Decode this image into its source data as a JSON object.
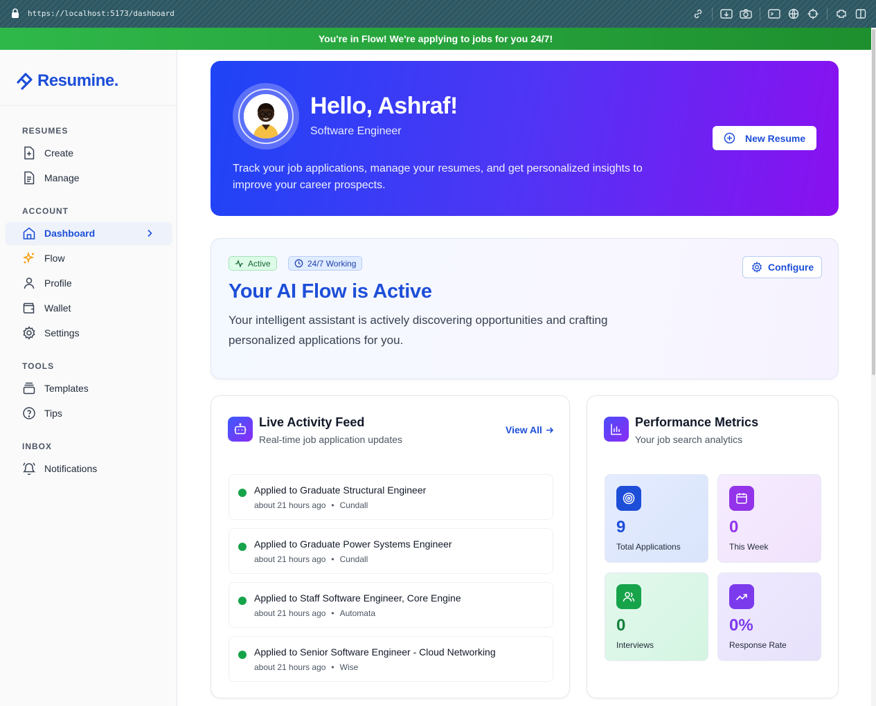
{
  "browser": {
    "url": "https://localhost:5173/dashboard"
  },
  "banner": {
    "text": "You're in Flow! We're applying to jobs for you 24/7!"
  },
  "sidebar": {
    "logo": "Resumine.",
    "sections": {
      "resumes": "RESUMES",
      "account": "ACCOUNT",
      "tools": "TOOLS",
      "inbox": "INBOX"
    },
    "items": {
      "create": "Create",
      "manage": "Manage",
      "dashboard": "Dashboard",
      "flow": "Flow",
      "profile": "Profile",
      "wallet": "Wallet",
      "settings": "Settings",
      "templates": "Templates",
      "tips": "Tips",
      "notifications": "Notifications"
    }
  },
  "hero": {
    "greeting": "Hello, Ashraf!",
    "role": "Software Engineer",
    "description": "Track your job applications, manage your resumes, and get personalized insights to improve your career prospects.",
    "new_resume": "New Resume"
  },
  "flow": {
    "badge_active": "Active",
    "badge_working": "24/7 Working",
    "configure": "Configure",
    "title": "Your AI Flow is Active",
    "description": "Your intelligent assistant is actively discovering opportunities and crafting personalized applications for you."
  },
  "feed": {
    "title": "Live Activity Feed",
    "subtitle": "Real-time job application updates",
    "view_all": "View All",
    "items": [
      {
        "title": "Applied to Graduate Structural Engineer",
        "time": "about 21 hours ago",
        "sep": "•",
        "company": "Cundall"
      },
      {
        "title": "Applied to Graduate Power Systems Engineer",
        "time": "about 21 hours ago",
        "sep": "•",
        "company": "Cundall"
      },
      {
        "title": "Applied to Staff Software Engineer, Core Engine",
        "time": "about 21 hours ago",
        "sep": "•",
        "company": "Automata"
      },
      {
        "title": "Applied to Senior Software Engineer - Cloud Networking",
        "time": "about 21 hours ago",
        "sep": "•",
        "company": "Wise"
      }
    ]
  },
  "metrics": {
    "title": "Performance Metrics",
    "subtitle": "Your job search analytics",
    "items": [
      {
        "value": "9",
        "label": "Total Applications",
        "icon": "target-icon",
        "color": "#1d4ed8"
      },
      {
        "value": "0",
        "label": "This Week",
        "icon": "calendar-icon",
        "color": "#9333ea"
      },
      {
        "value": "0",
        "label": "Interviews",
        "icon": "users-icon",
        "color": "#15803d"
      },
      {
        "value": "0%",
        "label": "Response Rate",
        "icon": "trending-up-icon",
        "color": "#7c3aed"
      }
    ]
  },
  "colors": {
    "brand": "#1d4ed8",
    "banner": "#22a83b",
    "hero_start": "#1e44f6",
    "hero_end": "#8a10f0",
    "status_dot": "#16a34a"
  }
}
